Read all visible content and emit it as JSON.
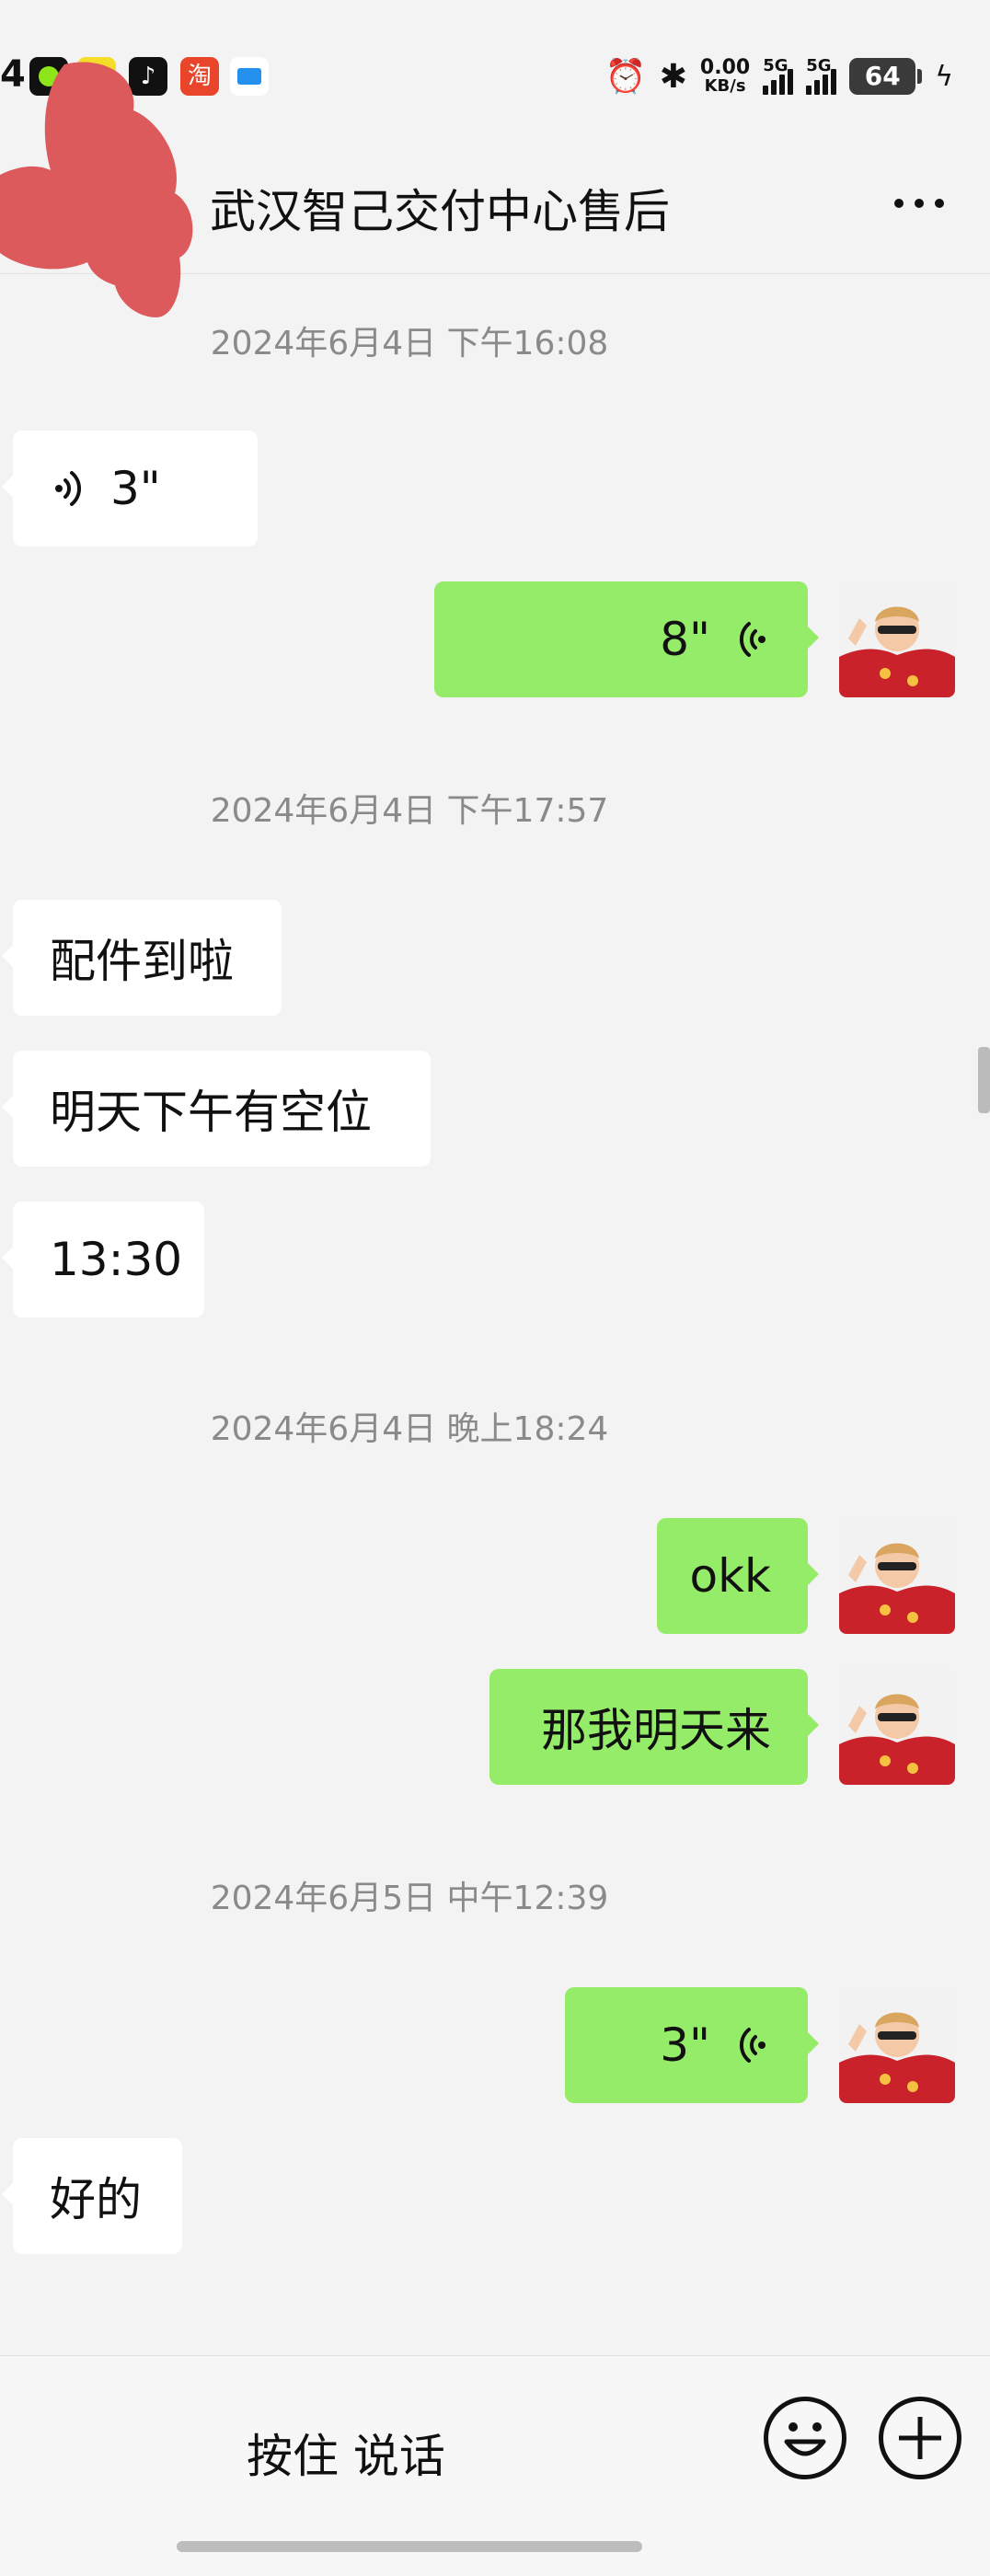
{
  "status_bar": {
    "time_partial": "4",
    "net_speed_value": "0.00",
    "net_speed_unit": "KB/s",
    "signal1_label": "5G",
    "signal2_label": "5G",
    "battery": "64"
  },
  "header": {
    "title": "，武汉智己交付中心售后"
  },
  "messages": [
    {
      "type": "timestamp",
      "text": "2024年6月4日 下午16:08"
    },
    {
      "type": "voice",
      "side": "in",
      "duration": "3\""
    },
    {
      "type": "voice",
      "side": "out",
      "duration": "8\""
    },
    {
      "type": "timestamp",
      "text": "2024年6月4日 下午17:57"
    },
    {
      "type": "text",
      "side": "in",
      "text": "配件到啦"
    },
    {
      "type": "text",
      "side": "in",
      "text": "明天下午有空位"
    },
    {
      "type": "text",
      "side": "in",
      "text": "13:30"
    },
    {
      "type": "timestamp",
      "text": "2024年6月4日 晚上18:24"
    },
    {
      "type": "text",
      "side": "out",
      "text": "okk"
    },
    {
      "type": "text",
      "side": "out",
      "text": "那我明天来"
    },
    {
      "type": "timestamp",
      "text": "2024年6月5日 中午12:39"
    },
    {
      "type": "voice",
      "side": "out",
      "duration": "3\""
    },
    {
      "type": "text",
      "side": "in",
      "text": "好的"
    }
  ],
  "bottom_bar": {
    "hold_to_talk": "按住 说话"
  },
  "colors": {
    "background": "#f3f3f3",
    "outgoing_bubble": "#95ec69",
    "incoming_bubble": "#ffffff",
    "timestamp_text": "#8a8a8a"
  }
}
